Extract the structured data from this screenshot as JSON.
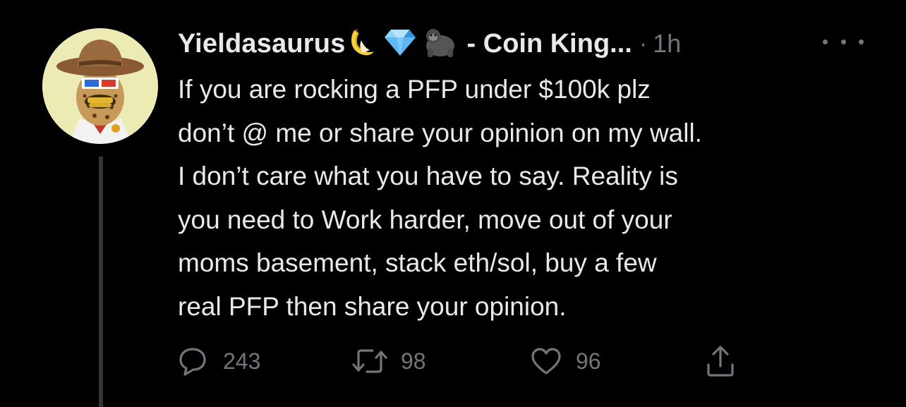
{
  "tweet": {
    "display_name": "Yieldasaurus",
    "name_emojis": [
      "banana-icon",
      "gem-icon",
      "gorilla-icon"
    ],
    "name_suffix": "- Coin King...",
    "separator": "·",
    "timestamp": "1h",
    "avatar": "bored-ape-cowboy-avatar",
    "body_lines": [
      "If you are rocking a PFP under $100k plz",
      "don’t @ me or share your opinion on my wall.",
      "I don’t care what you have to say. Reality is",
      "you need to Work harder, move out of your",
      "moms basement, stack eth/sol, buy a few",
      "real PFP then share your opinion."
    ],
    "actions": {
      "reply_count": "243",
      "retweet_count": "98",
      "like_count": "96"
    }
  },
  "colors": {
    "background": "#000000",
    "text": "#e7e9ea",
    "muted": "#71767b",
    "thread_line": "#333639"
  }
}
